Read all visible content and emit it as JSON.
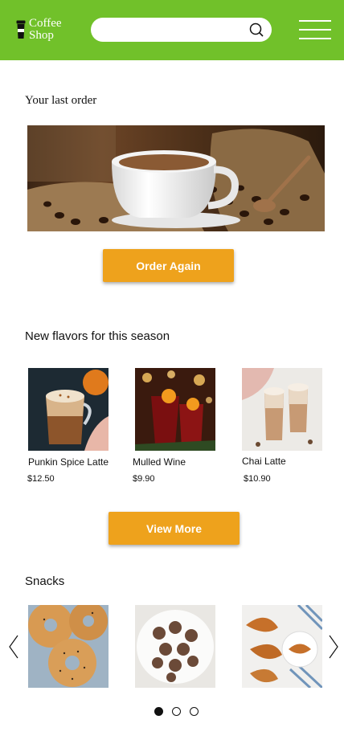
{
  "header": {
    "logo_line1": "Coffee",
    "logo_line2": "Shop",
    "search_value": "",
    "search_icon": "search-icon",
    "menu_icon": "hamburger-menu-icon"
  },
  "last_order": {
    "title": "Your last order",
    "image": "coffee-cup-with-beans-photo",
    "button_label": "Order Again"
  },
  "new_flavors": {
    "title": "New flavors for this season",
    "items": [
      {
        "name": "Punkin Spice Latte",
        "price": "$12.50",
        "image": "pumpkin-spice-latte-photo"
      },
      {
        "name": "Mulled Wine",
        "price": "$9.90",
        "image": "mulled-wine-photo"
      },
      {
        "name": "Chai Latte",
        "price": "$10.90",
        "image": "chai-latte-photo"
      }
    ],
    "button_label": "View More"
  },
  "snacks": {
    "title": "Snacks",
    "items": [
      {
        "image": "bagels-photo"
      },
      {
        "image": "energy-balls-photo"
      },
      {
        "image": "croissants-photo"
      }
    ],
    "prev_icon": "chevron-left-icon",
    "next_icon": "chevron-right-icon",
    "pagination": {
      "pages": 3,
      "current": 1
    }
  },
  "colors": {
    "header": "#71c12a",
    "button": "#eea21c",
    "text": "#111111"
  }
}
